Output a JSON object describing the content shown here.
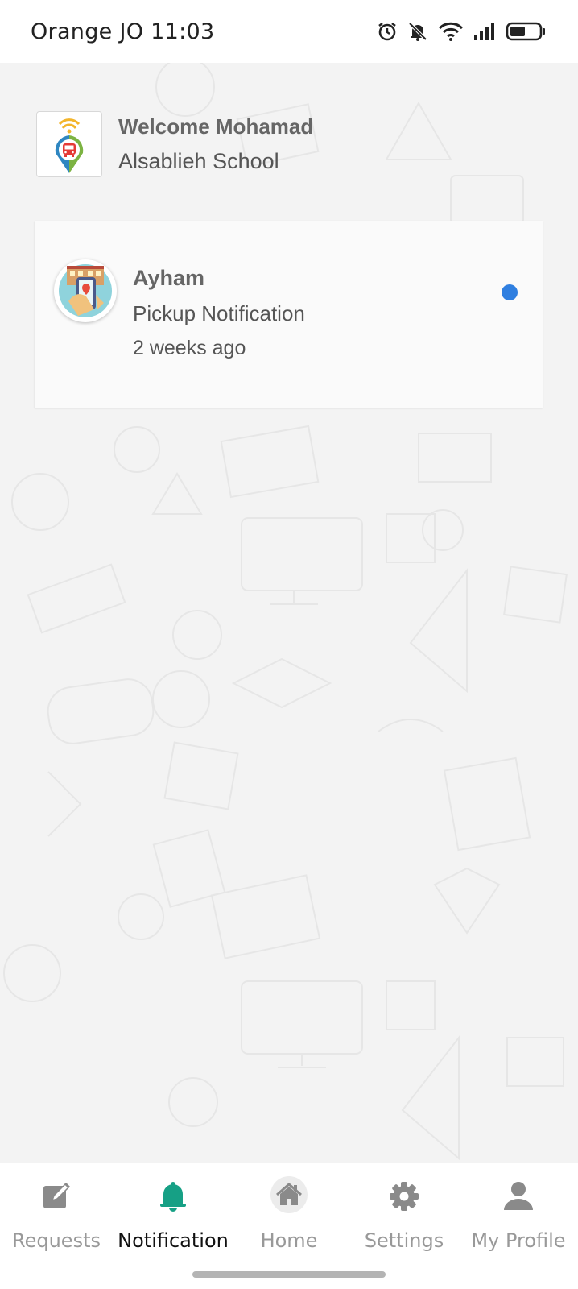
{
  "status_bar": {
    "carrier_time": "Orange JO 11:03",
    "icons": [
      "alarm-icon",
      "bell-muted-icon",
      "wifi-icon",
      "signal-icon",
      "battery-icon"
    ]
  },
  "header": {
    "welcome": "Welcome Mohamad",
    "school": "Alsablieh School",
    "logo_icon": "bus-location-logo-icon"
  },
  "notifications": [
    {
      "name": "Ayham",
      "type": "Pickup Notification",
      "time": "2 weeks ago",
      "unread": true
    }
  ],
  "bottom_nav": {
    "active": "Notification",
    "items": [
      {
        "label": "Requests",
        "icon": "edit-icon"
      },
      {
        "label": "Notification",
        "icon": "bell-icon"
      },
      {
        "label": "Home",
        "icon": "home-icon"
      },
      {
        "label": "Settings",
        "icon": "gear-icon"
      },
      {
        "label": "My Profile",
        "icon": "person-icon"
      }
    ]
  },
  "colors": {
    "accent": "#16a085",
    "unread_dot": "#2f7fe0",
    "background": "#f3f3f3",
    "inactive_nav": "#999999"
  }
}
